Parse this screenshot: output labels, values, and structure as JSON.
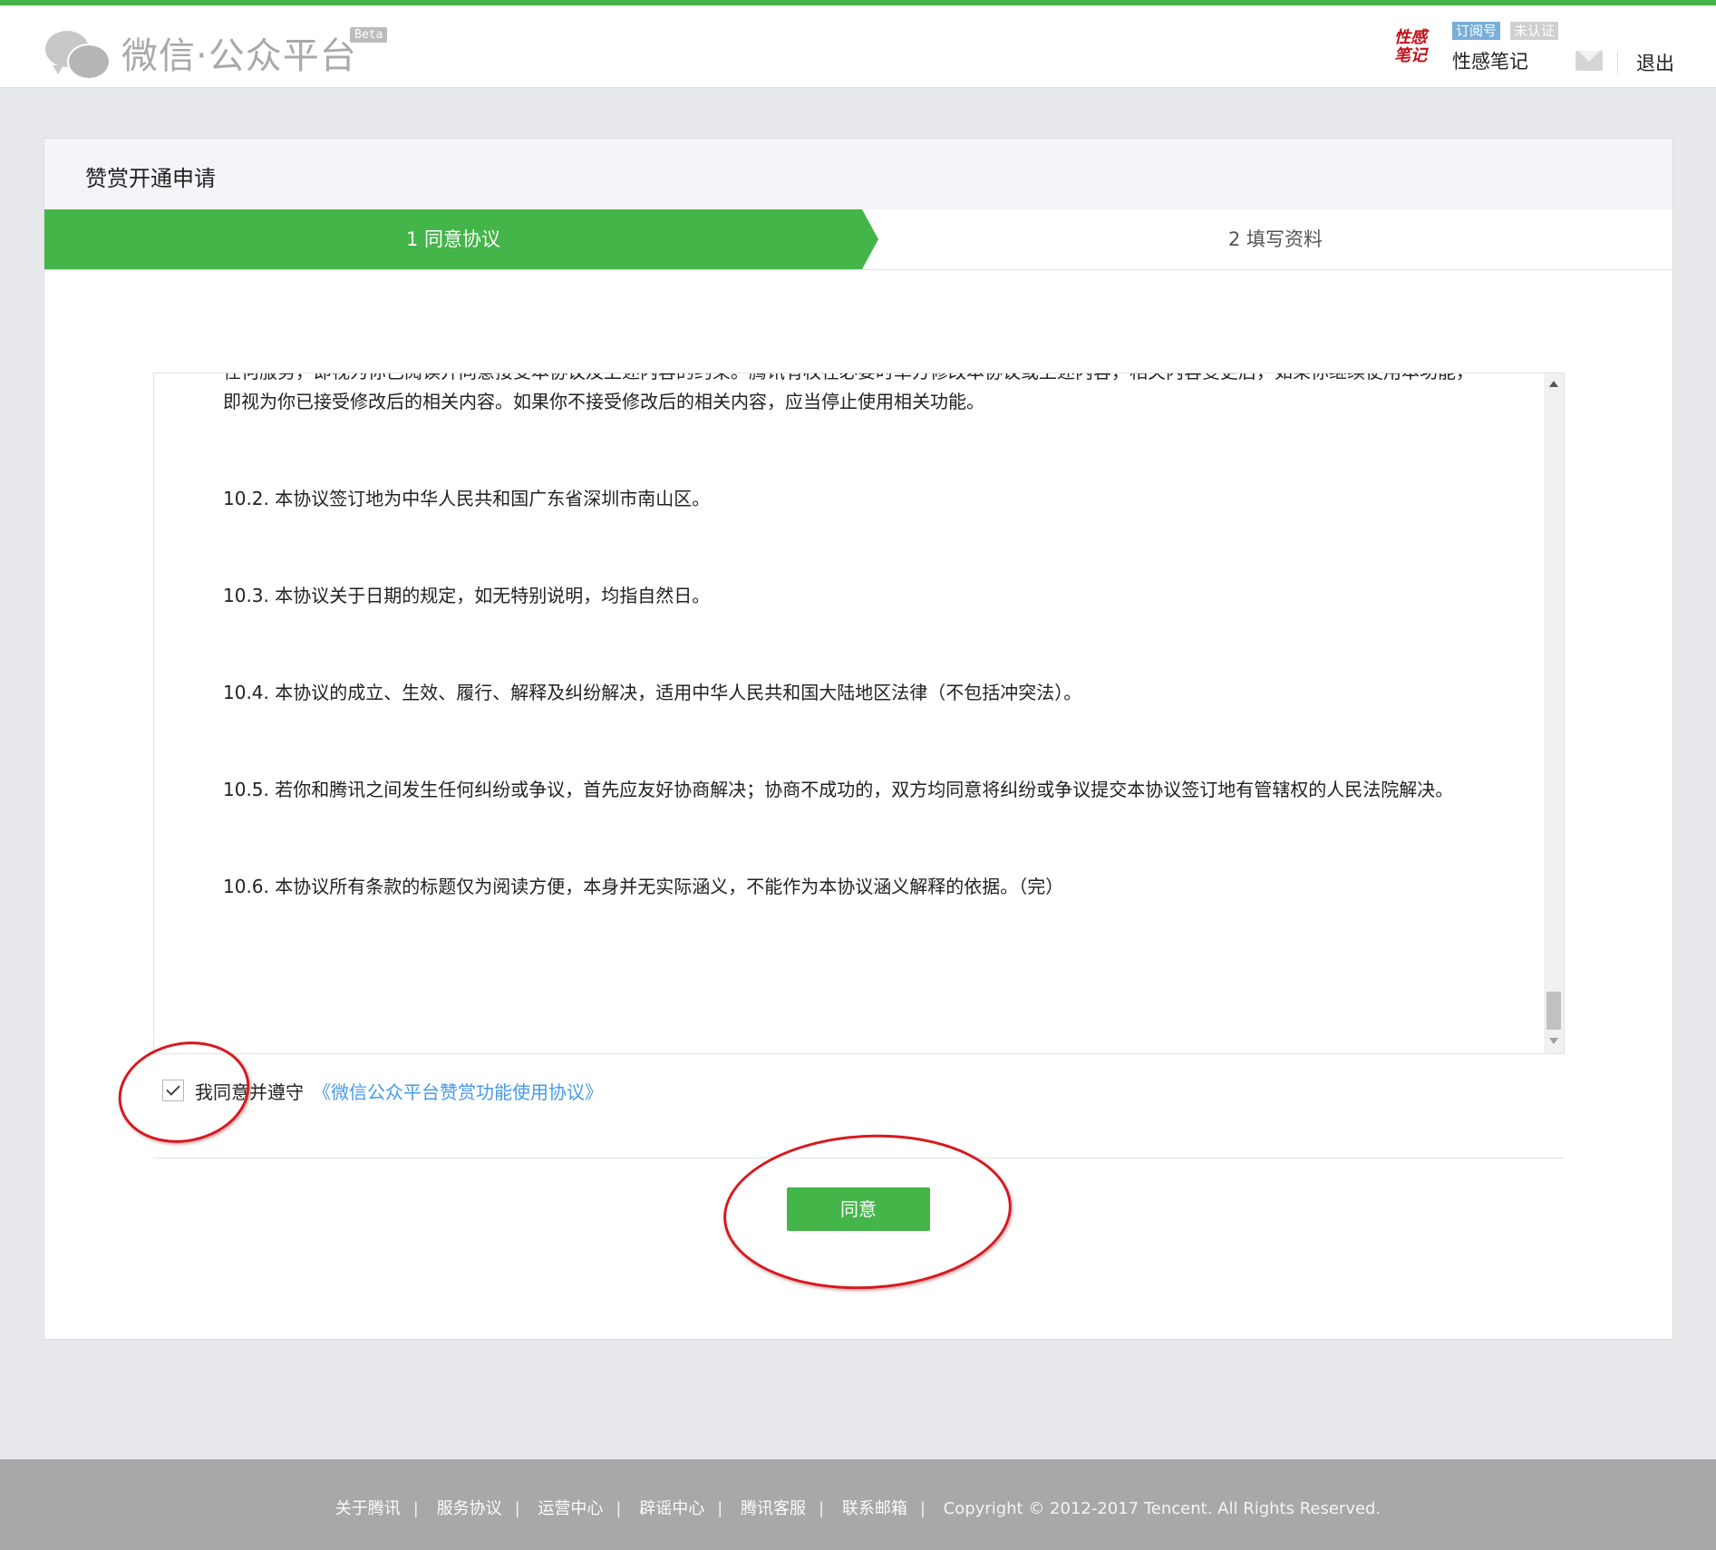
{
  "header": {
    "logo_text": "微信·公众平台",
    "beta_label": "Beta",
    "account_avatar_text": "性感笔记",
    "tag_subscription": "订阅号",
    "tag_unverified": "未认证",
    "account_name": "性感笔记",
    "logout_label": "退出"
  },
  "card": {
    "title": "赞赏开通申请",
    "steps": [
      {
        "label": "1 同意协议"
      },
      {
        "label": "2 填写资料"
      }
    ]
  },
  "agreement": {
    "paragraphs": [
      "任何服务，即视为你已阅读并同意接受本协议及上述内容的约束。腾讯有权在必要时单方修改本协议或上述内容，相关内容变更后，如果你继续使用本功能，即视为你已接受修改后的相关内容。如果你不接受修改后的相关内容，应当停止使用相关功能。",
      "10.2. 本协议签订地为中华人民共和国广东省深圳市南山区。",
      "10.3. 本协议关于日期的规定，如无特别说明，均指自然日。",
      "10.4. 本协议的成立、生效、履行、解释及纠纷解决，适用中华人民共和国大陆地区法律（不包括冲突法）。",
      "10.5. 若你和腾讯之间发生任何纠纷或争议，首先应友好协商解决；协商不成功的，双方均同意将纠纷或争议提交本协议签订地有管辖权的人民法院解决。",
      "10.6. 本协议所有条款的标题仅为阅读方便，本身并无实际涵义，不能作为本协议涵义解释的依据。（完）"
    ],
    "checkbox_checked": true,
    "agree_text": "我同意并遵守",
    "agree_link": "《微信公众平台赞赏功能使用协议》",
    "agree_button": "同意"
  },
  "footer": {
    "links": [
      "关于腾讯",
      "服务协议",
      "运营中心",
      "辟谣中心",
      "腾讯客服",
      "联系邮箱"
    ],
    "copyright": "Copyright © 2012-2017 Tencent. All Rights Reserved."
  },
  "colors": {
    "brand_green": "#44b549",
    "link_blue": "#459ae9",
    "annotation_red": "#d71920"
  }
}
